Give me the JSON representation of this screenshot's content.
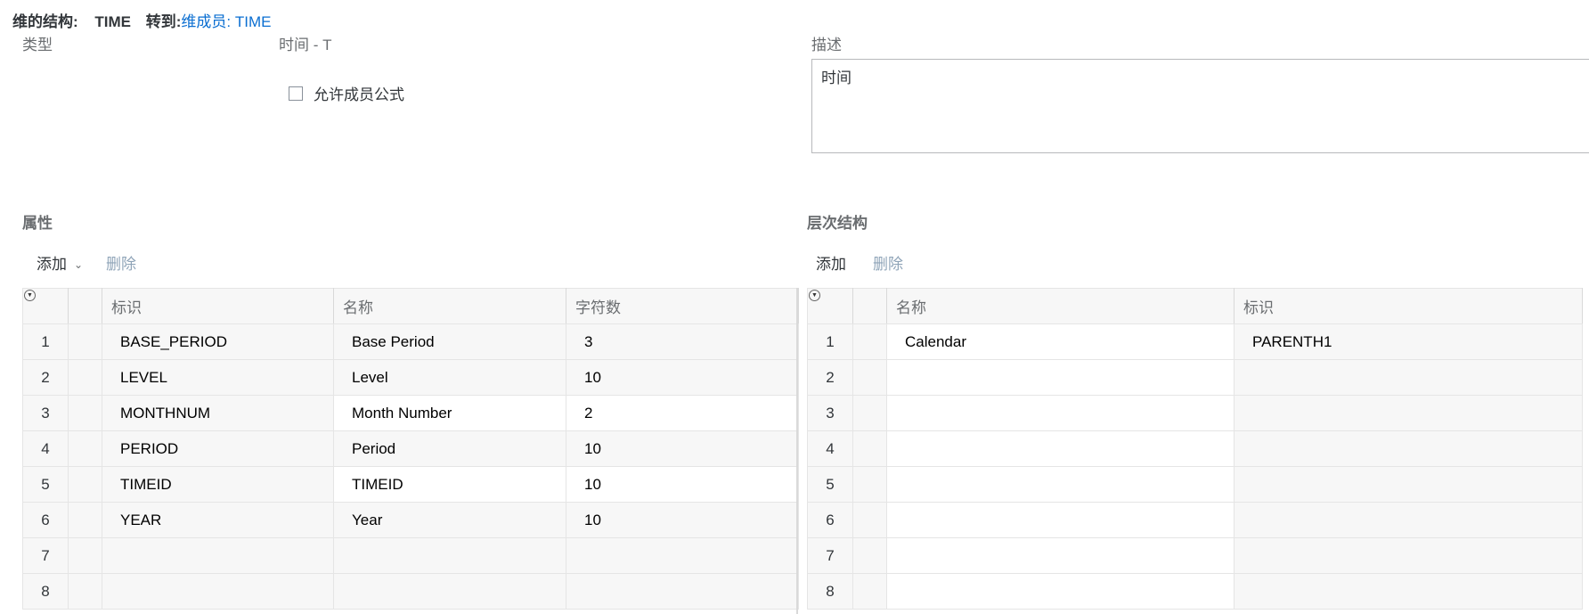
{
  "header": {
    "label": "维的结构:",
    "dimension": "TIME",
    "goto_label": "转到:",
    "goto_link": "维成员: TIME"
  },
  "form": {
    "type_label": "类型",
    "type_value": "时间  -  T",
    "allow_formula_label": "允许成员公式",
    "allow_formula_checked": false,
    "desc_label": "描述",
    "desc_value": "时间"
  },
  "attributes": {
    "title": "属性",
    "add_label": "添加",
    "delete_label": "删除",
    "columns": [
      "标识",
      "名称",
      "字符数"
    ],
    "rows": [
      {
        "num": "1",
        "id": "BASE_PERIOD",
        "name": "Base Period",
        "chars": "3"
      },
      {
        "num": "2",
        "id": "LEVEL",
        "name": "Level",
        "chars": "10"
      },
      {
        "num": "3",
        "id": "MONTHNUM",
        "name": "Month Number",
        "chars": "2"
      },
      {
        "num": "4",
        "id": "PERIOD",
        "name": "Period",
        "chars": "10"
      },
      {
        "num": "5",
        "id": "TIMEID",
        "name": "TIMEID",
        "chars": "10"
      },
      {
        "num": "6",
        "id": "YEAR",
        "name": "Year",
        "chars": "10"
      },
      {
        "num": "7",
        "id": "",
        "name": "",
        "chars": ""
      },
      {
        "num": "8",
        "id": "",
        "name": "",
        "chars": ""
      }
    ]
  },
  "hierarchy": {
    "title": "层次结构",
    "add_label": "添加",
    "delete_label": "删除",
    "columns": [
      "名称",
      "标识"
    ],
    "rows": [
      {
        "num": "1",
        "name": "Calendar",
        "id": "PARENTH1"
      },
      {
        "num": "2",
        "name": "",
        "id": ""
      },
      {
        "num": "3",
        "name": "",
        "id": ""
      },
      {
        "num": "4",
        "name": "",
        "id": ""
      },
      {
        "num": "5",
        "name": "",
        "id": ""
      },
      {
        "num": "6",
        "name": "",
        "id": ""
      },
      {
        "num": "7",
        "name": "",
        "id": ""
      },
      {
        "num": "8",
        "name": "",
        "id": ""
      }
    ]
  },
  "colors": {
    "link": "#0a6ed1",
    "disabled_action": "#8fa4b8",
    "grid_header_bg": "#f7f7f7"
  }
}
